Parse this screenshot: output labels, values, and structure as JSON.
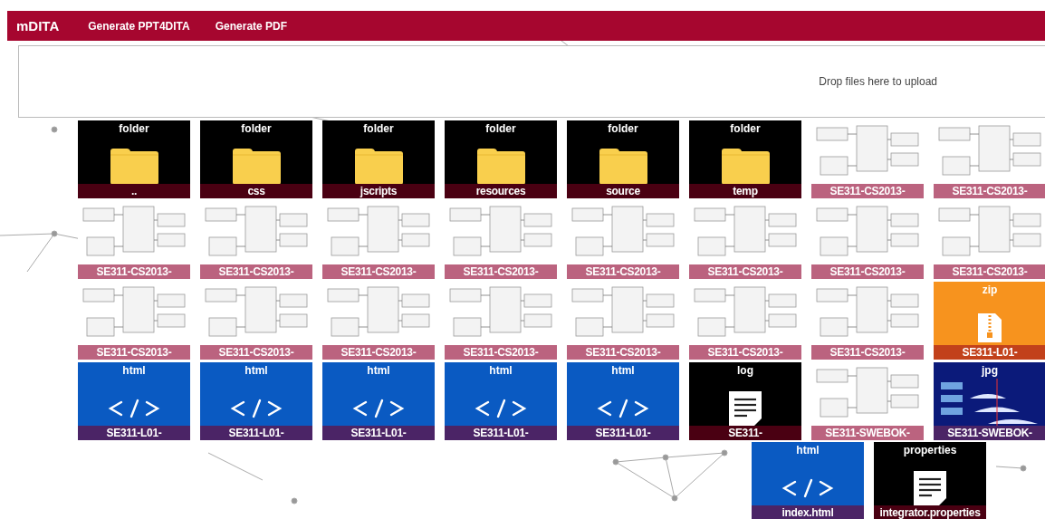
{
  "navbar": {
    "brand": "mDITA",
    "links": [
      "Generate PPT4DITA",
      "Generate PDF"
    ]
  },
  "dropzone": {
    "message": "Drop files here to upload"
  },
  "tiles": [
    {
      "kind": "folder",
      "type": "folder",
      "name": ".."
    },
    {
      "kind": "folder",
      "type": "folder",
      "name": "css"
    },
    {
      "kind": "folder",
      "type": "folder",
      "name": "jscripts"
    },
    {
      "kind": "folder",
      "type": "folder",
      "name": "resources"
    },
    {
      "kind": "folder",
      "type": "folder",
      "name": "source"
    },
    {
      "kind": "folder",
      "type": "folder",
      "name": "temp"
    },
    {
      "kind": "image",
      "name": "SE311-CS2013-"
    },
    {
      "kind": "image",
      "name": "SE311-CS2013-"
    },
    {
      "kind": "image",
      "name": "SE311-CS2013-"
    },
    {
      "kind": "image",
      "name": "SE311-CS2013-"
    },
    {
      "kind": "image",
      "name": "SE311-CS2013-"
    },
    {
      "kind": "image",
      "name": "SE311-CS2013-"
    },
    {
      "kind": "image",
      "name": "SE311-CS2013-"
    },
    {
      "kind": "image",
      "name": "SE311-CS2013-"
    },
    {
      "kind": "image",
      "name": "SE311-CS2013-"
    },
    {
      "kind": "image",
      "name": "SE311-CS2013-"
    },
    {
      "kind": "image",
      "name": "SE311-CS2013-"
    },
    {
      "kind": "image",
      "name": "SE311-CS2013-"
    },
    {
      "kind": "image",
      "name": "SE311-CS2013-"
    },
    {
      "kind": "image",
      "name": "SE311-CS2013-"
    },
    {
      "kind": "image",
      "name": "SE311-CS2013-"
    },
    {
      "kind": "image",
      "name": "SE311-CS2013-"
    },
    {
      "kind": "image",
      "name": "SE311-CS2013-"
    },
    {
      "kind": "zip",
      "type": "zip",
      "name": "SE311-L01-"
    },
    {
      "kind": "html",
      "type": "html",
      "name": "SE311-L01-"
    },
    {
      "kind": "html",
      "type": "html",
      "name": "SE311-L01-"
    },
    {
      "kind": "html",
      "type": "html",
      "name": "SE311-L01-"
    },
    {
      "kind": "html",
      "type": "html",
      "name": "SE311-L01-"
    },
    {
      "kind": "html",
      "type": "html",
      "name": "SE311-L01-"
    },
    {
      "kind": "doc",
      "type": "log",
      "name": "SE311-"
    },
    {
      "kind": "image",
      "name": "SE311-SWEBOK-"
    },
    {
      "kind": "photo",
      "type": "jpg",
      "name": "SE311-SWEBOK-"
    }
  ],
  "extra_tiles": [
    {
      "kind": "html",
      "type": "html",
      "name": "index.html"
    },
    {
      "kind": "doc",
      "type": "properties",
      "name": "integrator.properties"
    }
  ]
}
